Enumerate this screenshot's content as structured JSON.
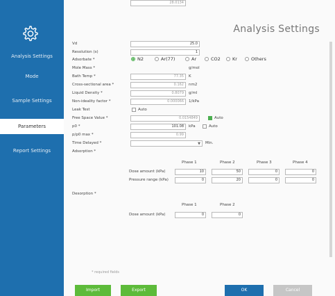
{
  "page": {
    "title": "Analysis Settings"
  },
  "sidebar": {
    "items": [
      {
        "label": "Analysis Settings"
      },
      {
        "label": "Mode"
      },
      {
        "label": "Sample Settings"
      },
      {
        "label": "Parameters"
      },
      {
        "label": "Report Settings"
      }
    ]
  },
  "form": {
    "vd": {
      "label": "Vd",
      "value": "25.0"
    },
    "resolution": {
      "label": "Resolution (s)",
      "value": "1"
    },
    "adsorbate": {
      "label": "Adsorbate *",
      "options": [
        "N2",
        "Ar(77)",
        "Ar",
        "CO2",
        "Kr",
        "Others"
      ],
      "selected": "N2"
    },
    "mole_mass": {
      "label": "Mole Mass *",
      "value": "28.0134",
      "unit": "g/mol"
    },
    "bath_temp": {
      "label": "Bath Temp *",
      "value": "77.35",
      "unit": "K"
    },
    "cross_sectional_area": {
      "label": "Cross-sectional area *",
      "value": "0.162",
      "unit": "nm2"
    },
    "liquid_density": {
      "label": "Liquid Density *",
      "value": "0.8079",
      "unit": "g/ml"
    },
    "non_ideality_factor": {
      "label": "Non-ideality factor *",
      "value": "0.000066",
      "unit": "1/kPa"
    },
    "leak_test": {
      "label": "Leak Test",
      "checkbox": "Auto"
    },
    "free_space_value": {
      "label": "Free Space Value *",
      "value": "0.0154849",
      "checkbox": "Auto"
    },
    "p0": {
      "label": "p0 *",
      "value": "101.08",
      "unit": "kPa",
      "checkbox": "Auto"
    },
    "p_p0_max": {
      "label": "p/p0 max *",
      "value": "0.99"
    },
    "time_delayed": {
      "label": "Time Delayed *",
      "unit": "Min."
    },
    "adsorption": {
      "label": "Adsorption *",
      "phases": [
        "Phase 1",
        "Phase 2",
        "Phase 3",
        "Phase 4"
      ],
      "rows": [
        {
          "label": "Dose amount (kPa)",
          "values": [
            "10",
            "50",
            "0",
            "0"
          ]
        },
        {
          "label": "Pressure range (kPa)",
          "values": [
            "0",
            "20",
            "0",
            "0"
          ]
        }
      ]
    },
    "desorption": {
      "label": "Desorption *",
      "phases": [
        "Phase 1",
        "Phase 2"
      ],
      "rows": [
        {
          "label": "Dose amount (kPa)",
          "values": [
            "0",
            "0"
          ]
        }
      ]
    },
    "required_note": "* required fields"
  },
  "buttons": {
    "import": "Import",
    "export": "Export",
    "ok": "OK",
    "cancel": "Cancel"
  },
  "colors": {
    "sidebar": "#1e6fae",
    "green": "#5dbb3a",
    "accent_radio": "#4caf50"
  }
}
